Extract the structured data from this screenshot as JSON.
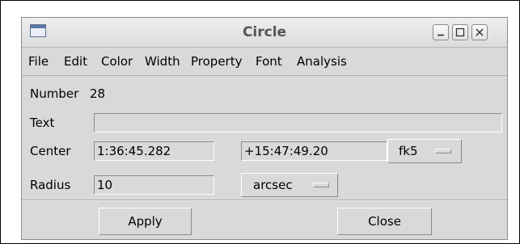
{
  "window": {
    "title": "Circle"
  },
  "menu": {
    "items": [
      "File",
      "Edit",
      "Color",
      "Width",
      "Property",
      "Font",
      "Analysis"
    ]
  },
  "form": {
    "number_label": "Number",
    "number_value": "28",
    "text_label": "Text",
    "text_value": "",
    "center_label": "Center",
    "center_ra": "1:36:45.282",
    "center_dec": "+15:47:49.20",
    "coord_system": "fk5",
    "radius_label": "Radius",
    "radius_value": "10",
    "radius_unit": "arcsec"
  },
  "buttons": {
    "apply": "Apply",
    "close": "Close"
  },
  "icons": {
    "window": "window-icon",
    "minimize": "minimize-icon",
    "maximize": "maximize-icon",
    "close": "close-icon"
  }
}
